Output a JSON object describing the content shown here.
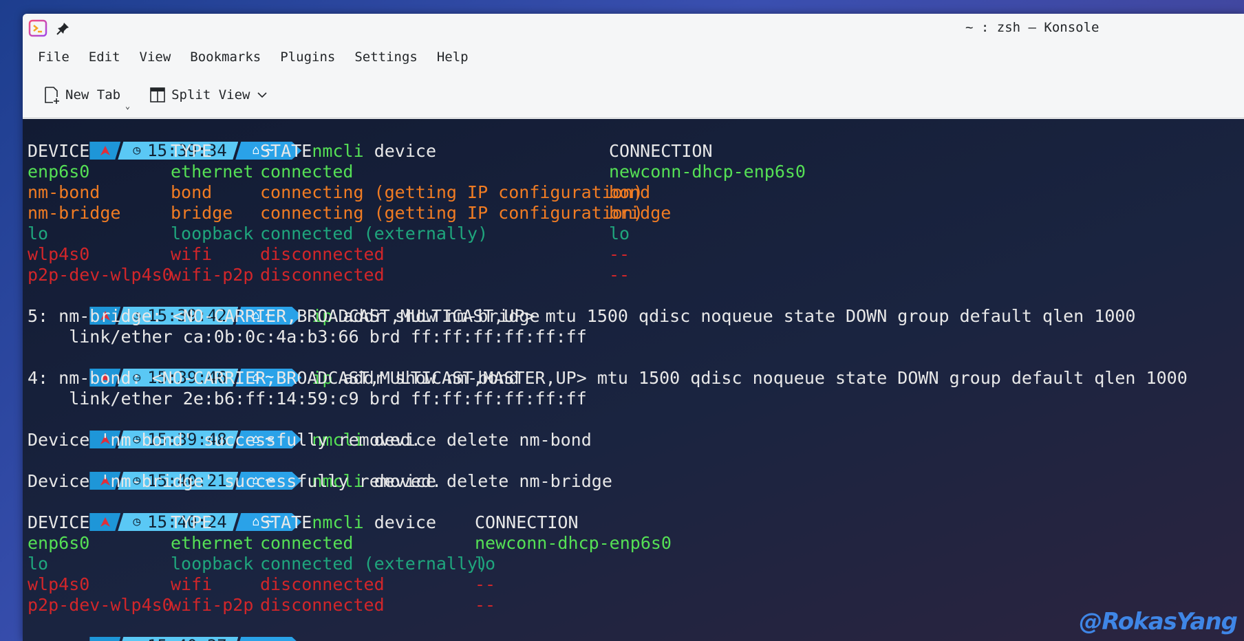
{
  "window": {
    "title": "~ : zsh — Konsole"
  },
  "menu": [
    "File",
    "Edit",
    "View",
    "Bookmarks",
    "Plugins",
    "Settings",
    "Help"
  ],
  "toolbar": {
    "new_tab": "New Tab",
    "split_view": "Split View"
  },
  "colors": {
    "green": "#55e055",
    "orange": "#f17c23",
    "teal": "#1fa67d",
    "red": "#d2262a",
    "prompt_time_bg": "#5ac8f5",
    "prompt_home_bg": "#2aa2e8"
  },
  "prompt_home": "~",
  "terminal": {
    "p1": {
      "time": "15:39:34",
      "cmd": "nmcli",
      "args": " device"
    },
    "t1": {
      "header": [
        "DEVICE",
        "TYPE",
        "STATE",
        "CONNECTION"
      ],
      "rows": [
        [
          "enp6s0",
          "ethernet",
          "connected",
          "newconn-dhcp-enp6s0"
        ],
        [
          "nm-bond",
          "bond",
          "connecting (getting IP configuration)",
          "bond"
        ],
        [
          "nm-bridge",
          "bridge",
          "connecting (getting IP configuration)",
          "bridge"
        ],
        [
          "lo",
          "loopback",
          "connected (externally)",
          "lo"
        ],
        [
          "wlp4s0",
          "wifi",
          "disconnected",
          "--"
        ],
        [
          "p2p-dev-wlp4s0",
          "wifi-p2p",
          "disconnected",
          "--"
        ]
      ]
    },
    "p2": {
      "time": "15:39:42",
      "cmd": "ip",
      "args": " addr show nm-bridge"
    },
    "o2": [
      "5: nm-bridge: <NO-CARRIER,BROADCAST,MULTICAST,UP> mtu 1500 qdisc noqueue state DOWN group default qlen 1000",
      "    link/ether ca:0b:0c:4a:b3:66 brd ff:ff:ff:ff:ff:ff"
    ],
    "p3": {
      "time": "15:39:46",
      "cmd": "ip",
      "args": " addr show nm-bond"
    },
    "o3": [
      "4: nm-bond: <NO-CARRIER,BROADCAST,MULTICAST,MASTER,UP> mtu 1500 qdisc noqueue state DOWN group default qlen 1000",
      "    link/ether 2e:b6:ff:14:59:c9 brd ff:ff:ff:ff:ff:ff"
    ],
    "p4": {
      "time": "15:39:48",
      "cmd": "nmcli",
      "args": " device delete nm-bond"
    },
    "o4": "Device 'nm-bond' successfully removed.",
    "p5": {
      "time": "15:40:21",
      "cmd": "nmcli",
      "args": " device delete nm-bridge"
    },
    "o5": "Device 'nm-bridge' successfully removed.",
    "p6": {
      "time": "15:40:24",
      "cmd": "nmcli",
      "args": " device"
    },
    "t2": {
      "header": [
        "DEVICE",
        "TYPE",
        "STATE",
        "CONNECTION"
      ],
      "rows": [
        [
          "enp6s0",
          "ethernet",
          "connected",
          "newconn-dhcp-enp6s0"
        ],
        [
          "lo",
          "loopback",
          "connected (externally)",
          "lo"
        ],
        [
          "wlp4s0",
          "wifi",
          "disconnected",
          "--"
        ],
        [
          "p2p-dev-wlp4s0",
          "wifi-p2p",
          "disconnected",
          "--"
        ]
      ]
    },
    "p7": {
      "time": "15:40:37"
    }
  },
  "watermark": "@RokasYang"
}
